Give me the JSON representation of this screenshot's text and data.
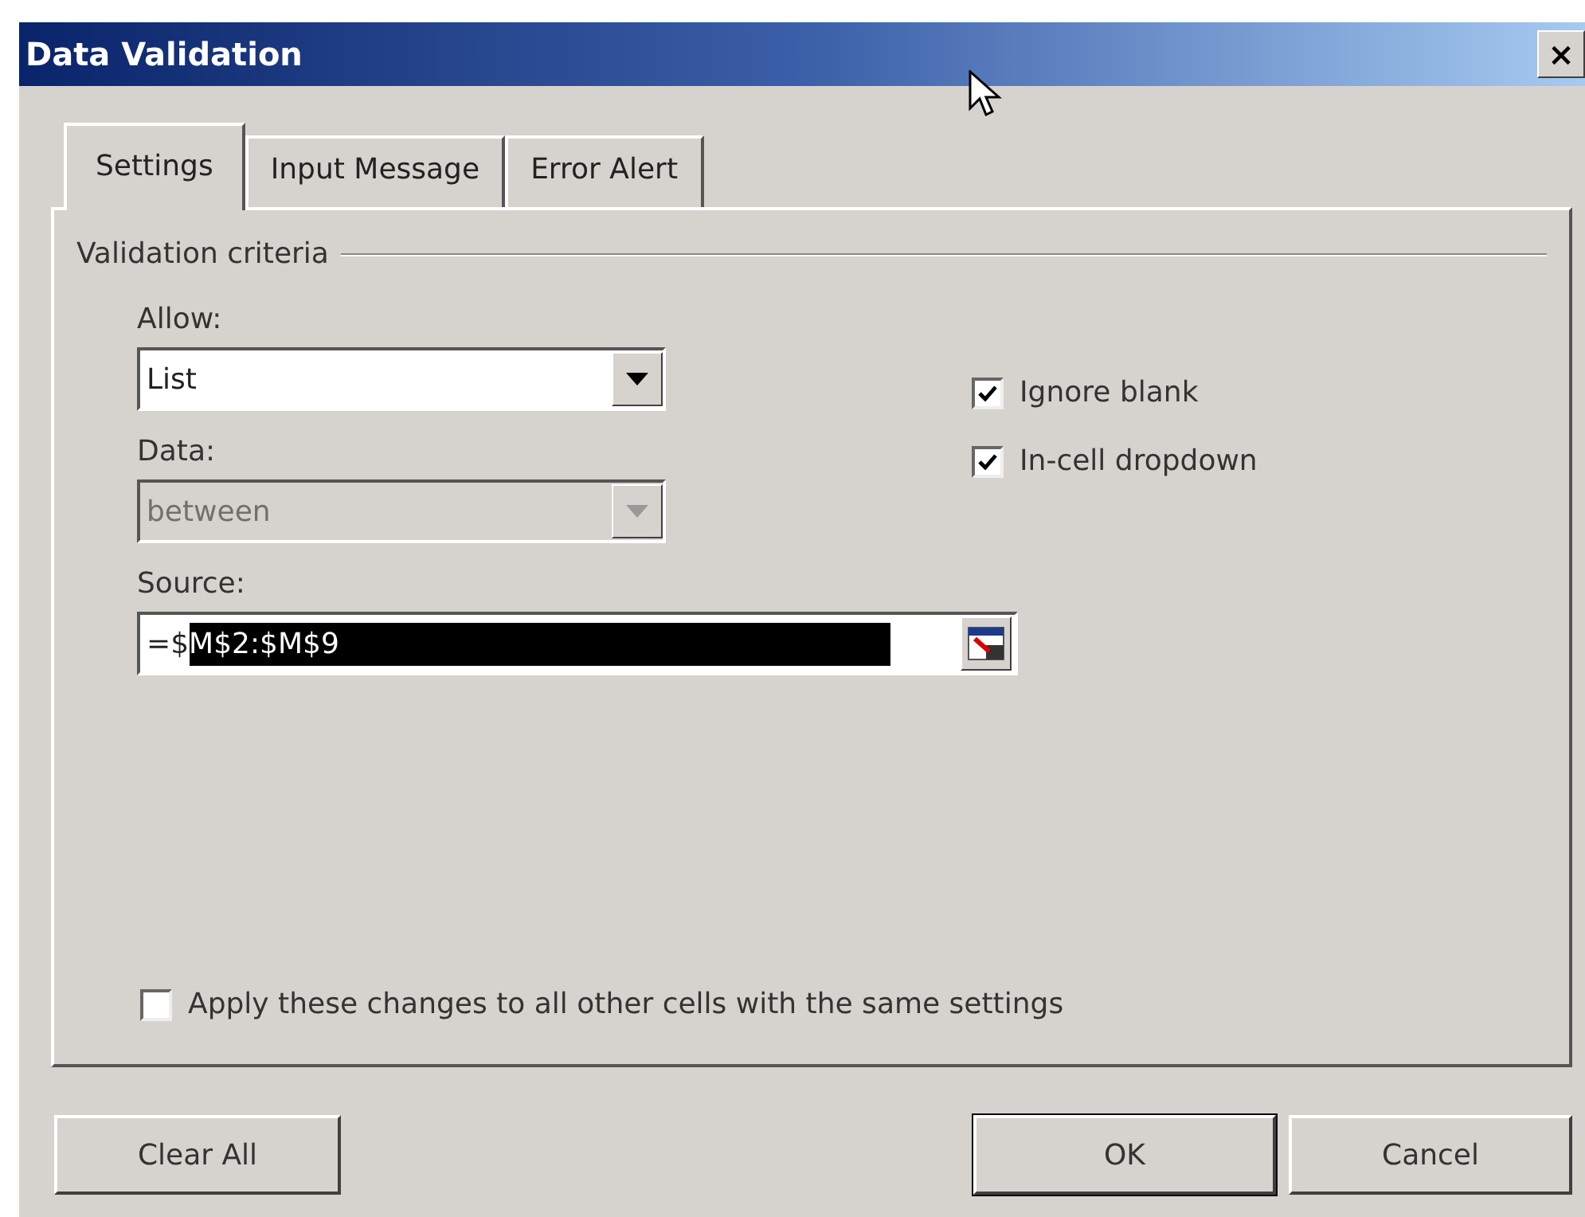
{
  "window": {
    "title": "Data Validation",
    "close": "×"
  },
  "tabs": [
    {
      "label": "Settings",
      "selected": true
    },
    {
      "label": "Input Message",
      "selected": false
    },
    {
      "label": "Error Alert",
      "selected": false
    }
  ],
  "group": {
    "title": "Validation criteria"
  },
  "allow": {
    "label": "Allow:",
    "value": "List",
    "disabled": false
  },
  "data": {
    "label": "Data:",
    "value": "between",
    "disabled": true
  },
  "source": {
    "label": "Source:",
    "value_unselected": "=$",
    "value_selected": "M$2:$M$9"
  },
  "options": [
    {
      "label": "Ignore blank",
      "checked": true
    },
    {
      "label": "In-cell dropdown",
      "checked": true
    }
  ],
  "apply_all": {
    "label": "Apply these changes to all other cells with the same settings",
    "checked": false
  },
  "buttons": [
    {
      "label": "Clear All",
      "default": false
    },
    {
      "label": "OK",
      "default": true
    },
    {
      "label": "Cancel",
      "default": false
    }
  ]
}
